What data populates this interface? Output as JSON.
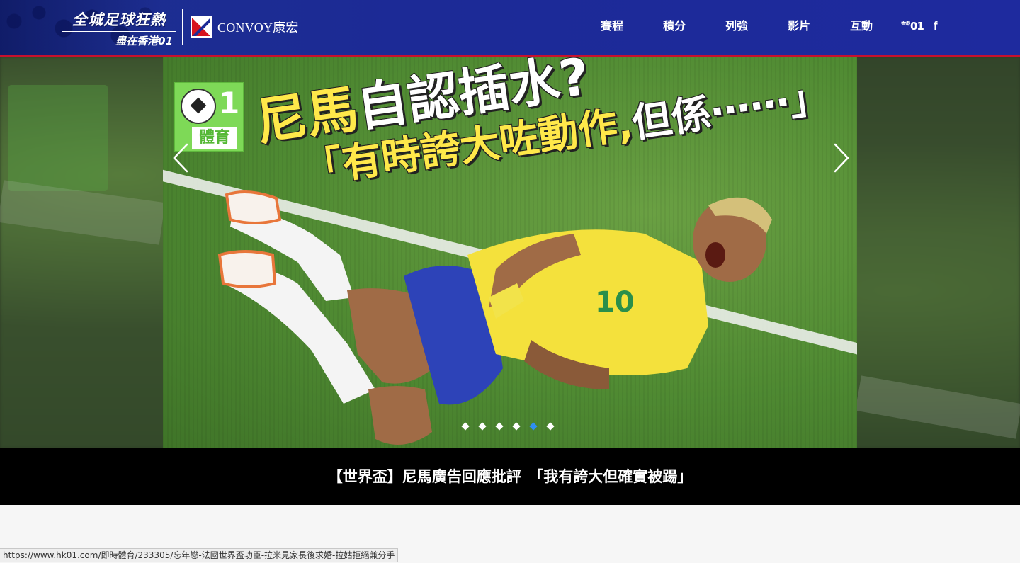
{
  "header": {
    "logo_line1": "全城足球狂熱",
    "logo_line2": "盡在香港01",
    "sponsor": "CONVOY康宏",
    "nav": [
      "賽程",
      "積分",
      "列強",
      "影片",
      "互動"
    ],
    "social": {
      "hk01_icon": "01",
      "facebook_icon": "f"
    }
  },
  "hero": {
    "badge_number": "1",
    "badge_label": "體育",
    "headline_line1_part1": "尼馬",
    "headline_line1_part2": "自認插水?",
    "headline_line2_part1": "「有時誇大咗動作,",
    "headline_line2_part2": "但係⋯⋯」",
    "jersey_number": "10",
    "slide_count": 6,
    "active_slide": 5
  },
  "caption": "【世界盃】尼馬廣告回應批評　「我有誇大但確實被踼」",
  "status_url": "https://www.hk01.com/即時體育/233305/忘年戀-法國世界盃功臣-拉米見家長後求婚-拉姑拒絕兼分手",
  "colors": {
    "header_blue": "#1c2a96",
    "accent_red": "#c8102e",
    "dot_active": "#2f8ff2",
    "badge_green": "#7ed957",
    "headline_yellow": "#ffe84a"
  }
}
